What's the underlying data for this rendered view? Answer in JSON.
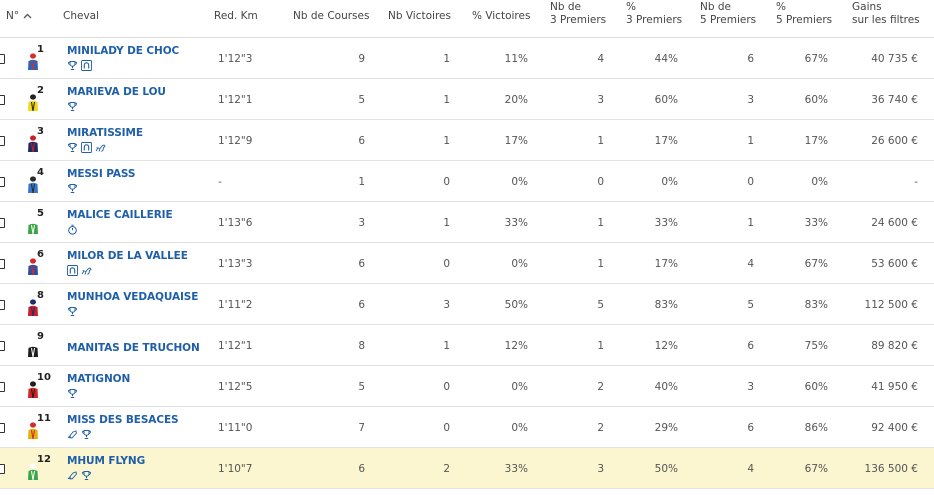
{
  "headers": {
    "num": "N°",
    "sort_icon": "chevron-up-icon",
    "cheval": "Cheval",
    "red_km": "Red. Km",
    "nb_courses": "Nb de Courses",
    "nb_victoires": "Nb Victoires",
    "pct_victoires": "% Victoires",
    "nb3_l1": "Nb de",
    "nb3_l2": "3 Premiers",
    "pct3_l1": "%",
    "pct3_l2": "3 Premiers",
    "nb5_l1": "Nb de",
    "nb5_l2": "5 Premiers",
    "pct5_l1": "%",
    "pct5_l2": "5 Premiers",
    "gains_l1": "Gains",
    "gains_l2": "sur les filtres"
  },
  "colors": {
    "link": "#1f5fa8",
    "highlight": "#fbf6cf"
  },
  "rows": [
    {
      "num": "1",
      "name": "MINILADY DE CHOC",
      "icons": [
        "trophy",
        "horseshoe"
      ],
      "red": "1'12\"3",
      "courses": "9",
      "vict": "1",
      "pvict": "11%",
      "nb3": "4",
      "p3": "44%",
      "nb5": "6",
      "p5": "67%",
      "gains": "40 735 €",
      "silk": [
        "#2a63b8",
        "#d23030"
      ]
    },
    {
      "num": "2",
      "name": "MARIEVA DE LOU",
      "icons": [
        "trophy"
      ],
      "red": "1'12\"1",
      "courses": "5",
      "vict": "1",
      "pvict": "20%",
      "nb3": "3",
      "p3": "60%",
      "nb5": "3",
      "p5": "60%",
      "gains": "36 740 €",
      "silk": [
        "#f2d81a",
        "#222222"
      ]
    },
    {
      "num": "3",
      "name": "MIRATISSIME",
      "icons": [
        "trophy",
        "horseshoe",
        "horse"
      ],
      "red": "1'12\"9",
      "courses": "6",
      "vict": "1",
      "pvict": "17%",
      "nb3": "1",
      "p3": "17%",
      "nb5": "1",
      "p5": "17%",
      "gains": "26 600 €",
      "silk": [
        "#1e2a66",
        "#c8202a"
      ]
    },
    {
      "num": "4",
      "name": "MESSI PASS",
      "icons": [
        "trophy"
      ],
      "red": "-",
      "courses": "1",
      "vict": "0",
      "pvict": "0%",
      "nb3": "0",
      "p3": "0%",
      "nb5": "0",
      "p5": "0%",
      "gains": "-",
      "silk": [
        "#3a78c9",
        "#2a2a2a"
      ]
    },
    {
      "num": "5",
      "name": "MALICE CAILLERIE",
      "icons": [
        "stopwatch"
      ],
      "red": "1'13\"6",
      "courses": "3",
      "vict": "1",
      "pvict": "33%",
      "nb3": "1",
      "p3": "33%",
      "nb5": "1",
      "p5": "33%",
      "gains": "24 600 €",
      "silk": [
        "#3aa548",
        "#ffffff"
      ]
    },
    {
      "num": "6",
      "name": "MILOR DE LA VALLEE",
      "icons": [
        "horseshoe",
        "horse"
      ],
      "red": "1'13\"3",
      "courses": "6",
      "vict": "0",
      "pvict": "0%",
      "nb3": "1",
      "p3": "17%",
      "nb5": "4",
      "p5": "67%",
      "gains": "53 600 €",
      "silk": [
        "#2c4fa0",
        "#d02c2c"
      ]
    },
    {
      "num": "8",
      "name": "MUNHOA VEDAQUAISE",
      "icons": [
        "trophy"
      ],
      "red": "1'11\"2",
      "courses": "6",
      "vict": "3",
      "pvict": "50%",
      "nb3": "5",
      "p3": "83%",
      "nb5": "5",
      "p5": "83%",
      "gains": "112 500 €",
      "silk": [
        "#c82028",
        "#1b2f6e"
      ]
    },
    {
      "num": "9",
      "name": "MANITAS DE TRUCHON",
      "icons": [],
      "red": "1'12\"1",
      "courses": "8",
      "vict": "1",
      "pvict": "12%",
      "nb3": "1",
      "p3": "12%",
      "nb5": "6",
      "p5": "75%",
      "gains": "89 820 €",
      "silk": [
        "#1c1c1c",
        "#ffffff"
      ]
    },
    {
      "num": "10",
      "name": "MATIGNON",
      "icons": [
        "trophy"
      ],
      "red": "1'12\"5",
      "courses": "5",
      "vict": "0",
      "pvict": "0%",
      "nb3": "2",
      "p3": "40%",
      "nb5": "3",
      "p5": "60%",
      "gains": "41 950 €",
      "silk": [
        "#d42424",
        "#1e1e1e"
      ]
    },
    {
      "num": "11",
      "name": "MISS DES BESACES",
      "icons": [
        "shoe",
        "trophy"
      ],
      "red": "1'11\"0",
      "courses": "7",
      "vict": "0",
      "pvict": "0%",
      "nb3": "2",
      "p3": "29%",
      "nb5": "6",
      "p5": "86%",
      "gains": "92 400 €",
      "silk": [
        "#e2b313",
        "#d02a2a"
      ]
    },
    {
      "num": "12",
      "name": "MHUM FLYNG",
      "icons": [
        "shoe",
        "trophy"
      ],
      "red": "1'10\"7",
      "courses": "6",
      "vict": "2",
      "pvict": "33%",
      "nb3": "3",
      "p3": "50%",
      "nb5": "4",
      "p5": "67%",
      "gains": "136 500 €",
      "silk": [
        "#3aa548",
        "#ffffff"
      ],
      "highlight": true
    }
  ]
}
